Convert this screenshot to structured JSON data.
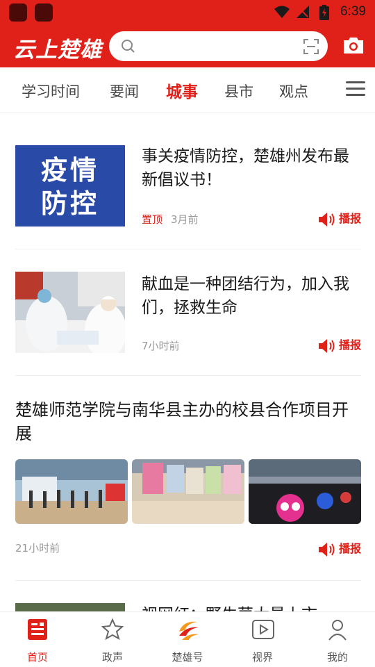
{
  "status_bar": {
    "time": "6:39"
  },
  "header": {
    "app_title": "云上楚雄",
    "search_placeholder": ""
  },
  "tabs": [
    {
      "label": "学习时间",
      "active": false
    },
    {
      "label": "要闻",
      "active": false
    },
    {
      "label": "城事",
      "active": true
    },
    {
      "label": "县市",
      "active": false
    },
    {
      "label": "观点",
      "active": false
    }
  ],
  "news": [
    {
      "title": "事关疫情防控，楚雄州发布最新倡议书！",
      "thumb_text": "疫情\n防控",
      "tag": "置顶",
      "time": "3月前",
      "listen": "播报"
    },
    {
      "title": "献血是一种团结行为，加入我们，拯救生命",
      "tag": "",
      "time": "7小时前",
      "listen": "播报"
    },
    {
      "title": "楚雄师范学院与南华县主办的校县合作项目开展",
      "tag": "",
      "time": "21小时前",
      "listen": "播报"
    },
    {
      "title": "视网红：野生菌大量上市",
      "tag": "",
      "time": "",
      "listen": ""
    }
  ],
  "thumb1": {
    "line1": "疫情",
    "line2": "防控"
  },
  "bottom_nav": [
    {
      "label": "首页",
      "active": true
    },
    {
      "label": "政声",
      "active": false
    },
    {
      "label": "楚雄号",
      "active": false
    },
    {
      "label": "视界",
      "active": false
    },
    {
      "label": "我的",
      "active": false
    }
  ],
  "colors": {
    "brand": "#e0211a",
    "thumb_blue": "#2a4aa8"
  }
}
